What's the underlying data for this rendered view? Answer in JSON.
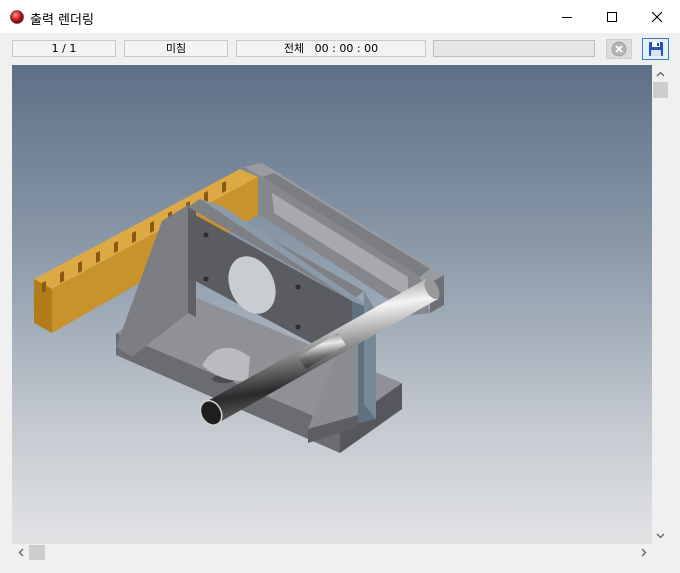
{
  "window": {
    "title": "출력 렌더링",
    "icon": "render-record-icon"
  },
  "status": {
    "page": "1 / 1",
    "state": "미침",
    "total_label": "전체",
    "total_time": "00 : 00 : 00"
  },
  "progress": {
    "fraction": 0.0
  },
  "toolbar": {
    "stop_icon": "stop-circle-x-icon",
    "save_icon": "floppy-disk-save-icon"
  },
  "scrollbars": {
    "vertical_position": 0.0,
    "horizontal_position": 0.0
  },
  "colors": {
    "viewport_top": "#5e6f86",
    "viewport_bottom": "#e2e3e5",
    "rack_gear": "#c8962e",
    "part_metal": "#8a8d93",
    "save_accent": "#3c78c8"
  }
}
